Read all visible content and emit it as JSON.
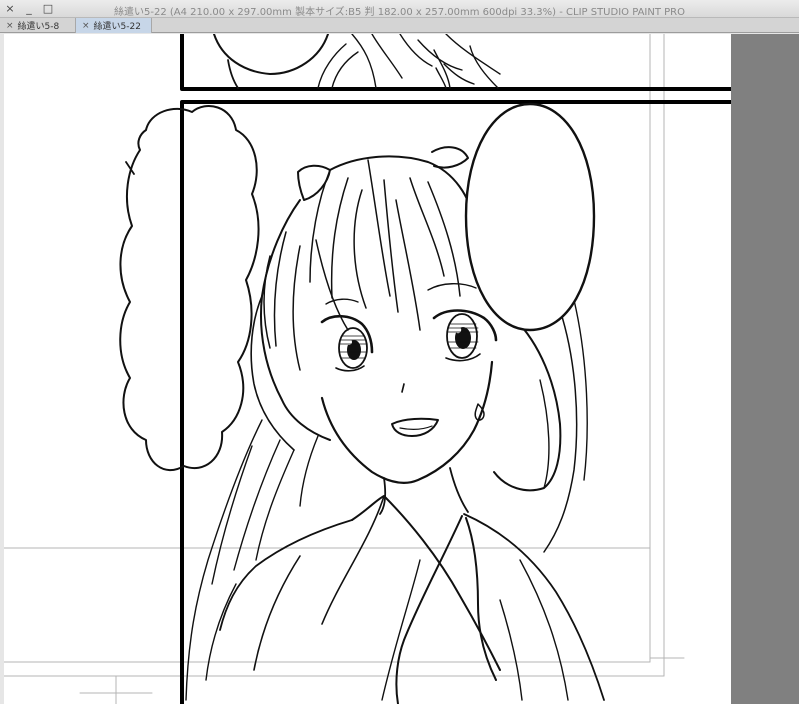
{
  "window": {
    "title": "絲遣い5-22 (A4 210.00 x 297.00mm 製本サイズ:B5 判 182.00 x 257.00mm 600dpi 33.3%)  - CLIP STUDIO PAINT PRO",
    "controls": [
      "×",
      "_",
      "□"
    ]
  },
  "tabs": [
    {
      "label": "絲遣い5-8",
      "active": false
    },
    {
      "label": "絲遣い5-22",
      "active": true
    }
  ],
  "colors": {
    "tab_active": "#c7d6e8",
    "canvas": "#ffffff",
    "gutter": "#808080",
    "ink": "#111111",
    "guide": "#a0a0a0"
  }
}
